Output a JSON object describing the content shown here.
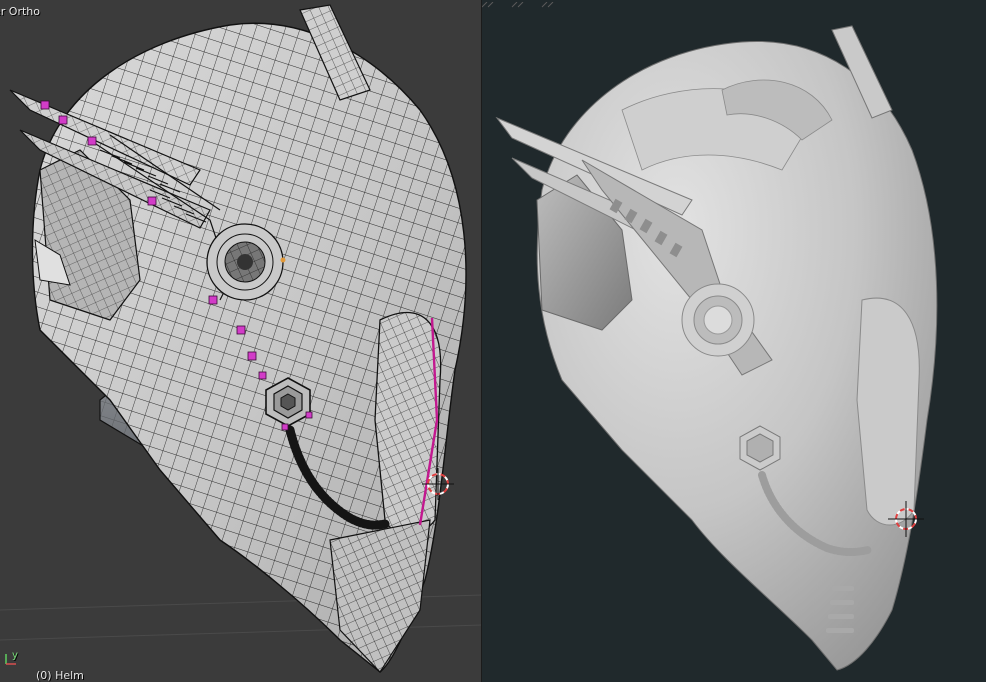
{
  "left_viewport": {
    "view_mode_label": "er Ortho",
    "object_label": "(0) Helm",
    "axis_gizmo_label": "y"
  },
  "right_viewport": {
    "background_color": "#20292c"
  },
  "colors": {
    "wire_bg": "#3b3b3b",
    "wire_stroke": "#111111",
    "mesh_fill": "#c9c9c9",
    "selected_vertex": "#d23cc8",
    "selected_edge": "#c2188f",
    "render_bg": "#20292c",
    "render_fill": "#c4c4c4"
  },
  "icons": [
    "3d-cursor-icon",
    "axis-gizmo-icon",
    "resize-handle-icon"
  ]
}
